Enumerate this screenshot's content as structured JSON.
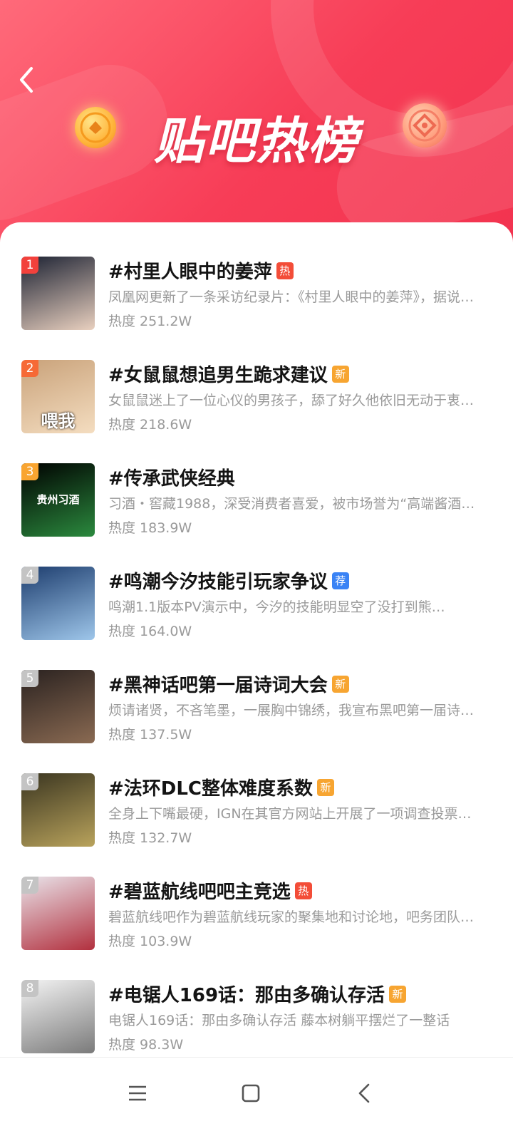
{
  "header": {
    "title": "贴吧热榜",
    "back_icon": "back-arrow-icon",
    "colors": {
      "gradient_start": "#ff6a7a",
      "gradient_end": "#f2334f"
    }
  },
  "tag_colors": {
    "热": "#f34d38",
    "新": "#f7a531",
    "荐": "#3a83f5"
  },
  "rank_colors": {
    "1": "#f2413c",
    "2": "#f66a36",
    "3": "#f9a531",
    "other": "#c4c4c4"
  },
  "items": [
    {
      "rank": "1",
      "title": "#村里人眼中的姜萍",
      "tag": "热",
      "desc": "凤凰网更新了一条采访纪录片：《村里人眼中的姜萍》，据说采访了…",
      "heat": "热度 251.2W",
      "thumb_colors": [
        "#1c2233",
        "#e9d0bf"
      ]
    },
    {
      "rank": "2",
      "title": "#女鼠鼠想追男生跪求建议",
      "tag": "新",
      "desc": "女鼠鼠迷上了一位心仪的男孩子，舔了好久他依旧无动于衷…",
      "heat": "热度 218.6W",
      "thumb_colors": [
        "#c9a27a",
        "#f4ddc0"
      ],
      "thumb_text": "喂我"
    },
    {
      "rank": "3",
      "title": "#传承武侠经典",
      "tag": "",
      "desc": "习酒・窖藏1988，深受消费者喜爱，被市场誉为“高端酱酒”…",
      "heat": "热度 183.9W",
      "thumb_colors": [
        "#000000",
        "#2b8a3e"
      ],
      "thumb_text": "贵州习酒"
    },
    {
      "rank": "4",
      "title": "#鸣潮今汐技能引玩家争议",
      "tag": "荐",
      "desc": "鸣潮1.1版本PV演示中，今汐的技能明显空了没打到熊…",
      "heat": "热度 164.0W",
      "thumb_colors": [
        "#1d3d6e",
        "#9ec6ea"
      ]
    },
    {
      "rank": "5",
      "title": "#黑神话吧第一届诗词大会",
      "tag": "新",
      "desc": "烦请诸贤，不吝笔墨，一展胸中锦绣，我宣布黑吧第一届诗词大会…",
      "heat": "热度 137.5W",
      "thumb_colors": [
        "#2a2220",
        "#8a6a52"
      ]
    },
    {
      "rank": "6",
      "title": "#法环DLC整体难度系数",
      "tag": "新",
      "desc": "全身上下嘴最硬，IGN在其官方网站上开展了一项调查投票…",
      "heat": "热度 132.7W",
      "thumb_colors": [
        "#3a3520",
        "#b9a35c"
      ]
    },
    {
      "rank": "7",
      "title": "#碧蓝航线吧吧主竞选",
      "tag": "热",
      "desc": "碧蓝航线吧作为碧蓝航线玩家的聚集地和讨论地，吧务团队…",
      "heat": "热度 103.9W",
      "thumb_colors": [
        "#e9e4ea",
        "#b2303e"
      ]
    },
    {
      "rank": "8",
      "title": "#电锯人169话：那由多确认存活",
      "tag": "新",
      "desc": "电锯人169话：那由多确认存活 藤本树躺平摆烂了一整话",
      "heat": "热度 98.3W",
      "thumb_colors": [
        "#f4f4f4",
        "#7a7a7a"
      ]
    }
  ],
  "nav": {
    "menu_icon": "menu-icon",
    "home_icon": "home-square-icon",
    "back_icon": "back-chevron-icon"
  }
}
